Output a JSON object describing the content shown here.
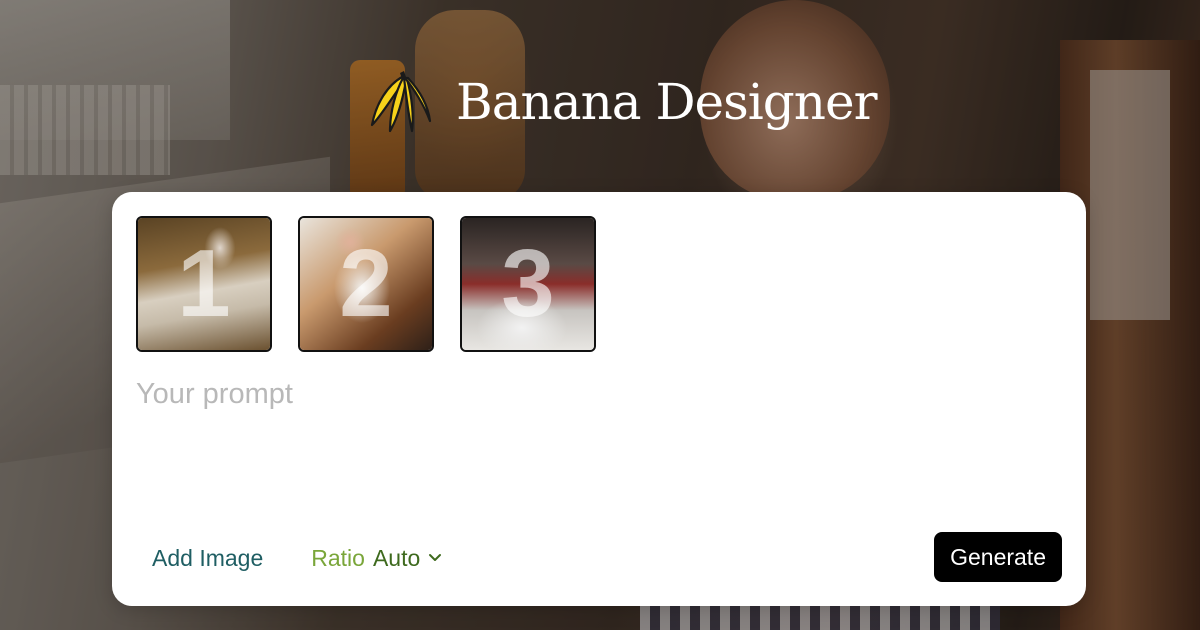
{
  "brand": {
    "name": "Banana Designer",
    "logo_icon": "banana-bunch-icon",
    "colors": {
      "banana_fill": "#f7d21a",
      "banana_outline": "#1a1a1a"
    }
  },
  "reference_images": [
    {
      "index": "1",
      "alt": "reference-photo-1"
    },
    {
      "index": "2",
      "alt": "reference-photo-2"
    },
    {
      "index": "3",
      "alt": "reference-photo-3"
    }
  ],
  "prompt": {
    "value": "",
    "placeholder": "Your prompt"
  },
  "actions": {
    "add_image_label": "Add Image",
    "ratio_label": "Ratio",
    "ratio_value": "Auto",
    "ratio_icon": "chevron-down-icon",
    "generate_label": "Generate"
  },
  "colors": {
    "add_image": "#1f5e63",
    "ratio_label": "#7aa63a",
    "ratio_value": "#3e6a1e",
    "generate_bg": "#000000",
    "card_bg": "#ffffff"
  }
}
